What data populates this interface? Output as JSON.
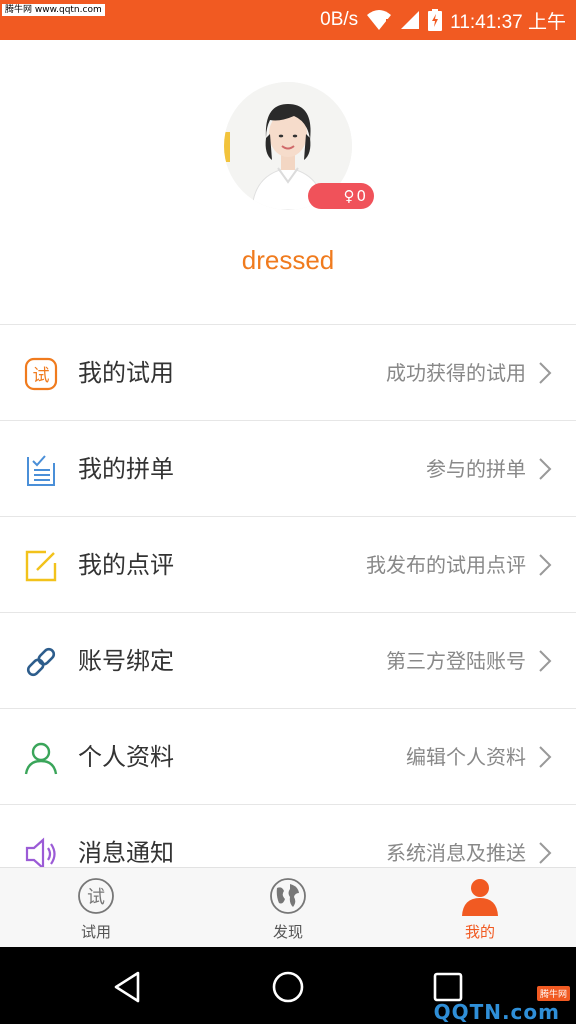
{
  "status_bar": {
    "watermark": "腾牛网 www.qqtn.com",
    "net_speed": "0B/s",
    "time": "11:41:37 上午"
  },
  "profile": {
    "username": "dressed",
    "gender_symbol": "♀",
    "count": "0"
  },
  "menu": {
    "items": [
      {
        "title": "我的试用",
        "subtitle": "成功获得的试用",
        "icon": "trial-icon",
        "color": "#f07b1e"
      },
      {
        "title": "我的拼单",
        "subtitle": "参与的拼单",
        "icon": "group-order-icon",
        "color": "#4a8fd8"
      },
      {
        "title": "我的点评",
        "subtitle": "我发布的试用点评",
        "icon": "review-icon",
        "color": "#f2c21b"
      },
      {
        "title": "账号绑定",
        "subtitle": "第三方登陆账号",
        "icon": "link-icon",
        "color": "#2d5d8c"
      },
      {
        "title": "个人资料",
        "subtitle": "编辑个人资料",
        "icon": "user-icon",
        "color": "#3aa55a"
      },
      {
        "title": "消息通知",
        "subtitle": "系统消息及推送",
        "icon": "speaker-icon",
        "color": "#9b5bd6"
      }
    ]
  },
  "tabs": {
    "trial": "试用",
    "discover": "发现",
    "mine": "我的"
  },
  "watermark_bottom": {
    "logo": "QQTN.com",
    "tag": "腾牛网"
  },
  "colors": {
    "brand": "#f15a22",
    "username": "#f07b1e",
    "badge": "#f0525a"
  }
}
